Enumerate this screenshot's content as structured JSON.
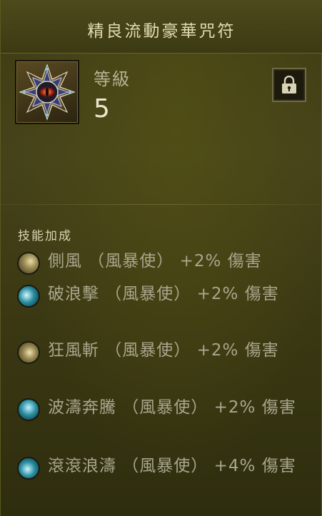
{
  "title": "精良流動豪華咒符",
  "level": {
    "label": "等級",
    "value": "5"
  },
  "lock_icon": "padlock-icon",
  "item_icon": "ornate-charm-gem-icon",
  "skill_bonus": {
    "header": "技能加成",
    "items": [
      {
        "text": "側風 （風暴使） +2% 傷害",
        "icon": "wind-swirl-icon",
        "color": "#9a8a52"
      },
      {
        "text": "破浪擊 （風暴使） +2% 傷害",
        "icon": "wave-strike-icon",
        "color": "#2a8fa0"
      },
      {
        "text": "狂風斬 （風暴使） +2% 傷害",
        "icon": "gale-slash-icon",
        "color": "#9a8a52"
      },
      {
        "text": "波濤奔騰 （風暴使） +2% 傷害",
        "icon": "surging-waves-icon",
        "color": "#2a8fa0"
      },
      {
        "text": "滾滾浪濤 （風暴使） +4% 傷害",
        "icon": "rolling-tide-icon",
        "color": "#2a8fa0"
      }
    ]
  },
  "colors": {
    "panel_background": "#3f3c14",
    "title_text": "#e3dbb2",
    "bonus_text": "#a9a68e",
    "gold_icon": "#9a8a52",
    "teal_icon": "#2a8fa0"
  }
}
